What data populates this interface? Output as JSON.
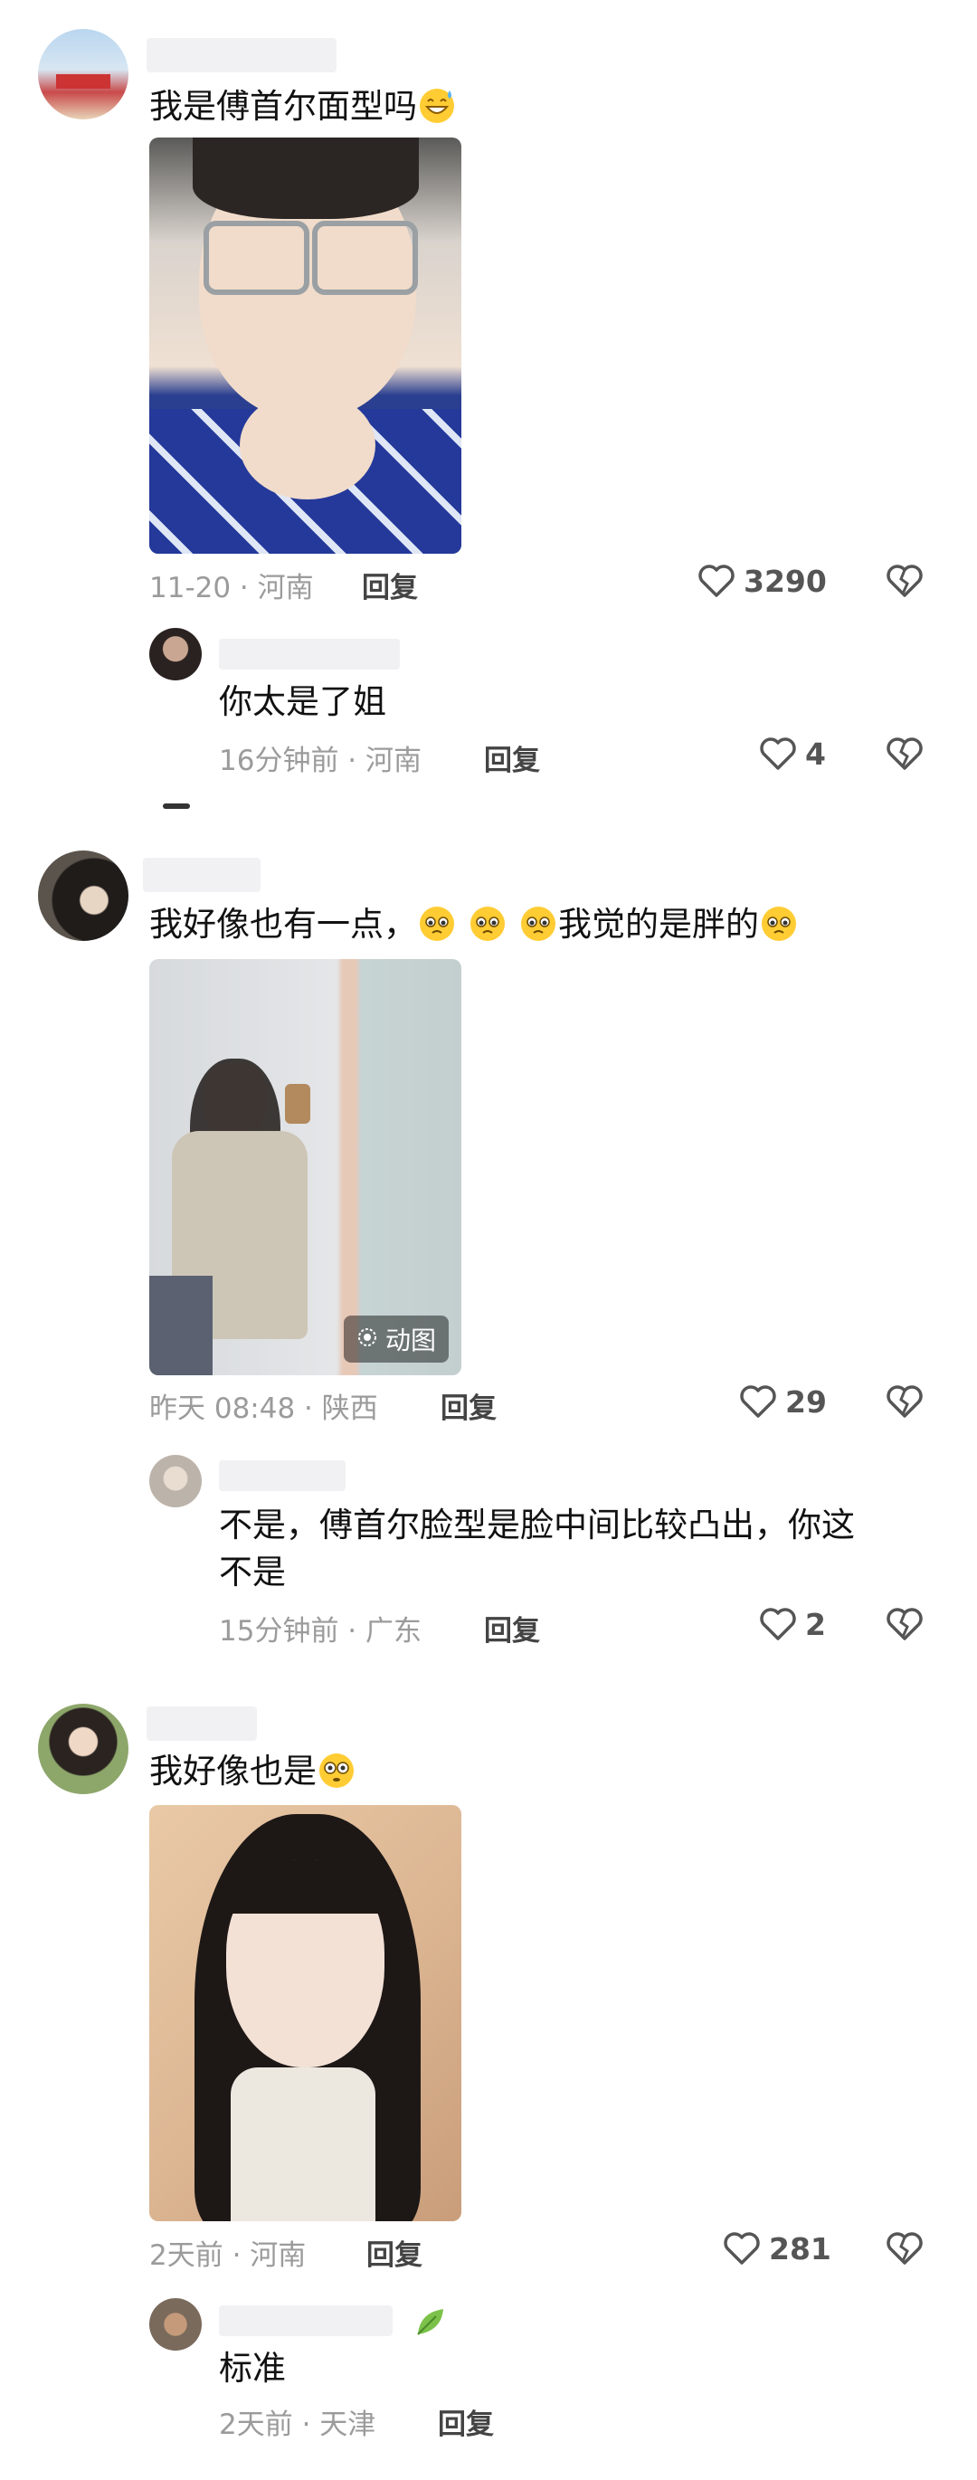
{
  "comments": [
    {
      "text": "我是傅首尔面型吗",
      "emoji_after": "grinning-sweat-emoji",
      "meta": "11-20 · 河南",
      "reply_label": "回复",
      "likes": "3290",
      "sub_reply": {
        "text": "你太是了姐",
        "meta": "16分钟前 · 河南",
        "reply_label": "回复",
        "likes": "4"
      }
    },
    {
      "text_before": "我好像也有一点，",
      "text_after": "我觉的是胖的",
      "badge": "动图",
      "meta": "昨天 08:48 · 陕西",
      "reply_label": "回复",
      "likes": "29",
      "sub_reply": {
        "text_line1": "不是，傅首尔脸型是脸中间比较凸出，你这",
        "text_line2": "不是",
        "meta": "15分钟前 · 广东",
        "reply_label": "回复",
        "likes": "2"
      }
    },
    {
      "text": "我好像也是",
      "meta": "2天前 · 河南",
      "reply_label": "回复",
      "likes": "281",
      "sub_reply": {
        "text": "标准",
        "meta": "2天前 · 天津",
        "reply_label": "回复"
      }
    }
  ],
  "colors": {
    "meta_gray": "#9b9b9b",
    "namebar": "#f1f1f3"
  }
}
